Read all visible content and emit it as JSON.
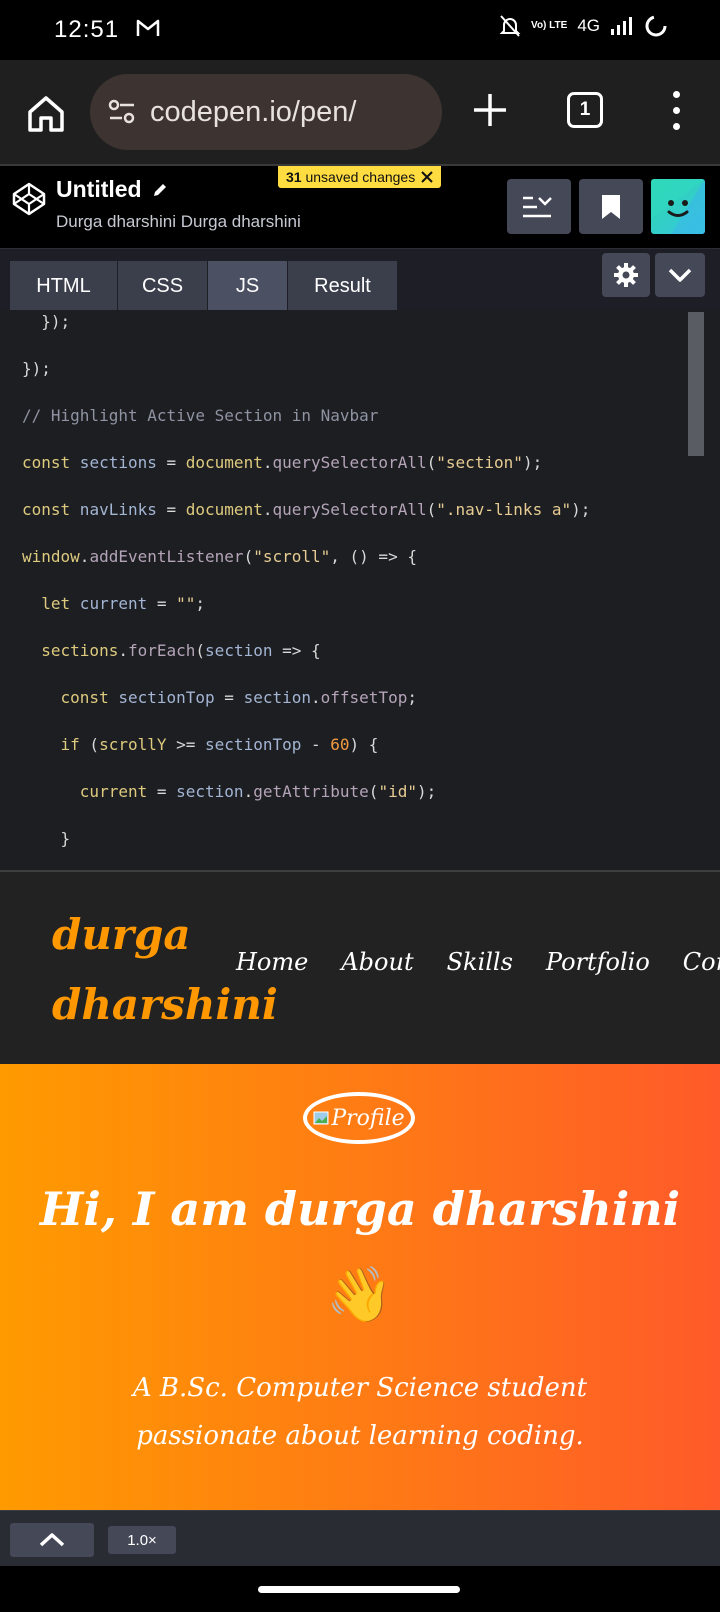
{
  "status_bar": {
    "time": "12:51",
    "network": "4G",
    "lte_label": "Vo) LTE",
    "icons": [
      "gmail-icon",
      "mute-icon",
      "signal-icon",
      "loading-icon"
    ]
  },
  "browser": {
    "url": "codepen.io/pen/",
    "tab_count": "1"
  },
  "codepen": {
    "title": "Untitled",
    "author": "Durga dharshini Durga dharshini",
    "unsaved_count": "31",
    "unsaved_label": "unsaved changes"
  },
  "editor_tabs": [
    {
      "label": "HTML"
    },
    {
      "label": "CSS"
    },
    {
      "label": "JS"
    },
    {
      "label": "Result"
    }
  ],
  "code": {
    "l1": "  });",
    "l2": "});",
    "l3": "// Highlight Active Section in Navbar",
    "l4a": "const",
    "l4b": " sections ",
    "l4c": "= ",
    "l4d": "document",
    "l4e": ".",
    "l4f": "querySelectorAll",
    "l4g": "(",
    "l4h": "\"section\"",
    "l4i": ");",
    "l5a": "const",
    "l5b": " navLinks ",
    "l5c": "= ",
    "l5d": "document",
    "l5e": ".",
    "l5f": "querySelectorAll",
    "l5g": "(",
    "l5h": "\".nav-links a\"",
    "l5i": ");",
    "l6a": "window",
    "l6b": ".",
    "l6c": "addEventListener",
    "l6d": "(",
    "l6e": "\"scroll\"",
    "l6f": ", () => {",
    "l7a": "  let",
    "l7b": " current ",
    "l7c": "= ",
    "l7d": "\"\"",
    "l7e": ";",
    "l8a": "  sections",
    "l8b": ".",
    "l8c": "forEach",
    "l8d": "(",
    "l8e": "section",
    "l8f": " => {",
    "l9a": "    const",
    "l9b": " sectionTop ",
    "l9c": "= ",
    "l9d": "section",
    "l9e": ".",
    "l9f": "offsetTop",
    "l9g": ";",
    "l10a": "    if",
    "l10b": " (",
    "l10c": "scrollY",
    "l10d": " >= ",
    "l10e": "sectionTop",
    "l10f": " - ",
    "l10g": "60",
    "l10h": ") {",
    "l11a": "      current ",
    "l11b": "= ",
    "l11c": "section",
    "l11d": ".",
    "l11e": "getAttribute",
    "l11f": "(",
    "l11g": "\"id\"",
    "l11h": ");",
    "l12": "    }"
  },
  "preview": {
    "logo_line1": "durga",
    "logo_line2": "dharshini",
    "nav_links": [
      "Home",
      "About",
      "Skills",
      "Portfolio",
      "Contact"
    ],
    "profile_alt": "Profile",
    "hero_title": "Hi, I am durga dharshini",
    "hero_wave": "👋",
    "hero_sub": "A B.Sc. Computer Science student passionate about learning coding."
  },
  "bottom": {
    "zoom": "1.0×"
  },
  "colors": {
    "accent": "#ff9800",
    "hero_start": "#ff9a00",
    "hero_end": "#ff5a29",
    "unsaved_badge": "#ffdd40"
  }
}
